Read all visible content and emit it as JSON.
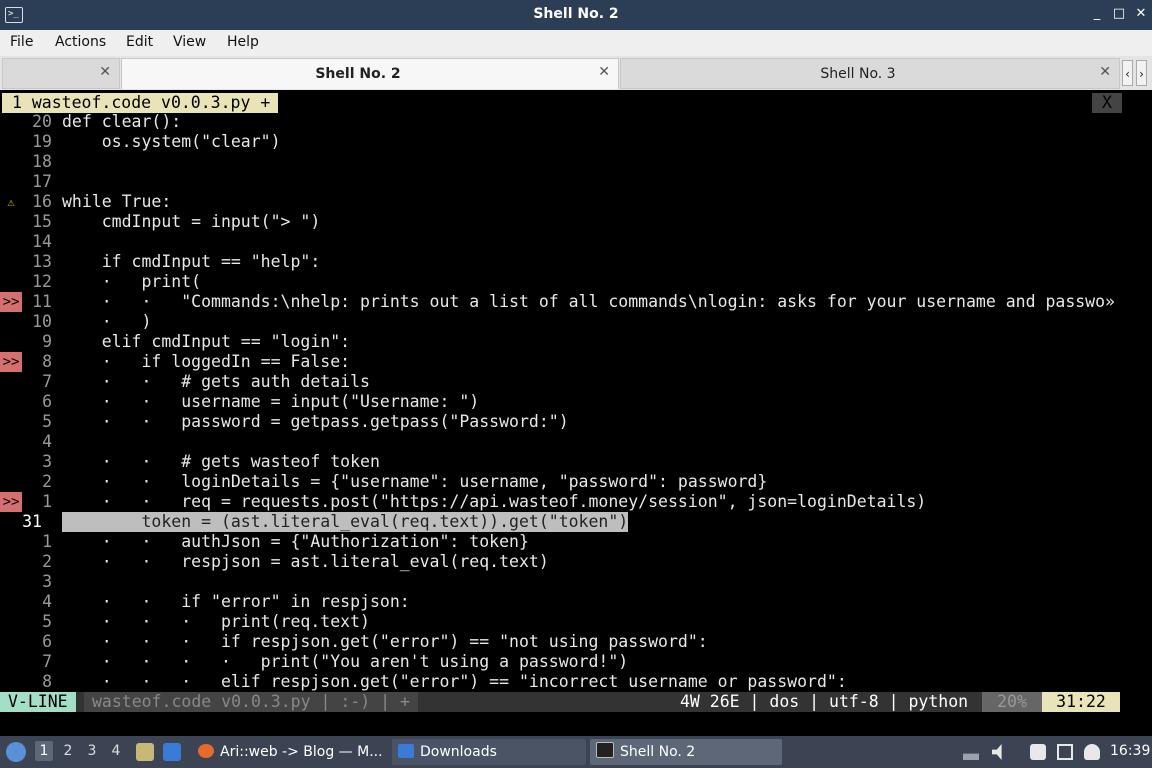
{
  "window": {
    "title": "Shell No. 2",
    "minimize": "_",
    "maximize": "□",
    "close": "✕"
  },
  "menu": [
    "File",
    "Actions",
    "Edit",
    "View",
    "Help"
  ],
  "tabs": [
    {
      "label": "",
      "close": "✕"
    },
    {
      "label": "Shell No. 2",
      "close": "✕"
    },
    {
      "label": "Shell No. 3",
      "close": "✕"
    }
  ],
  "tab_arrows": {
    "left": "‹",
    "right": "›"
  },
  "editor": {
    "buffer_tab": "1 wasteof.code v0.0.3.py +",
    "buffer_close": "X",
    "lines": [
      {
        "ln": "20",
        "sign": "",
        "text": "def clear():"
      },
      {
        "ln": "19",
        "sign": "",
        "text": "    os.system(\"clear\")"
      },
      {
        "ln": "18",
        "sign": "",
        "text": ""
      },
      {
        "ln": "17",
        "sign": "",
        "text": ""
      },
      {
        "ln": "16",
        "sign": "⚠",
        "text": "while True:"
      },
      {
        "ln": "15",
        "sign": "",
        "text": "    cmdInput = input(\"> \")"
      },
      {
        "ln": "14",
        "sign": "",
        "text": ""
      },
      {
        "ln": "13",
        "sign": "",
        "text": "    if cmdInput == \"help\":"
      },
      {
        "ln": "12",
        "sign": "",
        "text": "    ·   print("
      },
      {
        "ln": "11",
        "sign": ">>",
        "text": "    ·   ·   \"Commands:\\nhelp: prints out a list of all commands\\nlogin: asks for your username and passwo»"
      },
      {
        "ln": "10",
        "sign": "",
        "text": "    ·   )"
      },
      {
        "ln": "9",
        "sign": "",
        "text": "    elif cmdInput == \"login\":"
      },
      {
        "ln": "8",
        "sign": ">>",
        "text": "    ·   if loggedIn == False:"
      },
      {
        "ln": "7",
        "sign": "",
        "text": "    ·   ·   # gets auth details"
      },
      {
        "ln": "6",
        "sign": "",
        "text": "    ·   ·   username = input(\"Username: \")"
      },
      {
        "ln": "5",
        "sign": "",
        "text": "    ·   ·   password = getpass.getpass(\"Password:\")"
      },
      {
        "ln": "4",
        "sign": "",
        "text": ""
      },
      {
        "ln": "3",
        "sign": "",
        "text": "    ·   ·   # gets wasteof token"
      },
      {
        "ln": "2",
        "sign": "",
        "text": "    ·   ·   loginDetails = {\"username\": username, \"password\": password}"
      },
      {
        "ln": "1",
        "sign": ">>",
        "text": "    ·   ·   req = requests.post(\"https://api.wasteof.money/session\", json=loginDetails)"
      },
      {
        "ln": "31",
        "sign": "",
        "text": "        token = (ast.literal_eval(req.text)).get(\"token\")",
        "current": true
      },
      {
        "ln": "1",
        "sign": "",
        "text": "    ·   ·   authJson = {\"Authorization\": token}"
      },
      {
        "ln": "2",
        "sign": "",
        "text": "    ·   ·   respjson = ast.literal_eval(req.text)"
      },
      {
        "ln": "3",
        "sign": "",
        "text": ""
      },
      {
        "ln": "4",
        "sign": "",
        "text": "    ·   ·   if \"error\" in respjson:"
      },
      {
        "ln": "5",
        "sign": "",
        "text": "    ·   ·   ·   print(req.text)"
      },
      {
        "ln": "6",
        "sign": "",
        "text": "    ·   ·   ·   if respjson.get(\"error\") == \"not using password\":"
      },
      {
        "ln": "7",
        "sign": "",
        "text": "    ·   ·   ·   ·   print(\"You aren't using a password!\")"
      },
      {
        "ln": "8",
        "sign": "",
        "text": "    ·   ·   ·   elif respjson.get(\"error\") == \"incorrect username or password\":"
      }
    ],
    "status": {
      "mode": "V-LINE",
      "file": "wasteof.code v0.0.3.py | :-) | +",
      "right": "4W 26E | dos | utf-8 | python",
      "percent": "20%",
      "position": "31:22"
    }
  },
  "taskbar": {
    "workspaces": [
      "1",
      "2",
      "3",
      "4"
    ],
    "tasks": [
      {
        "label": "Ari::web -> Blog — M..."
      },
      {
        "label": "Downloads"
      },
      {
        "label": "Shell No. 2"
      }
    ],
    "clock": "16:39"
  }
}
